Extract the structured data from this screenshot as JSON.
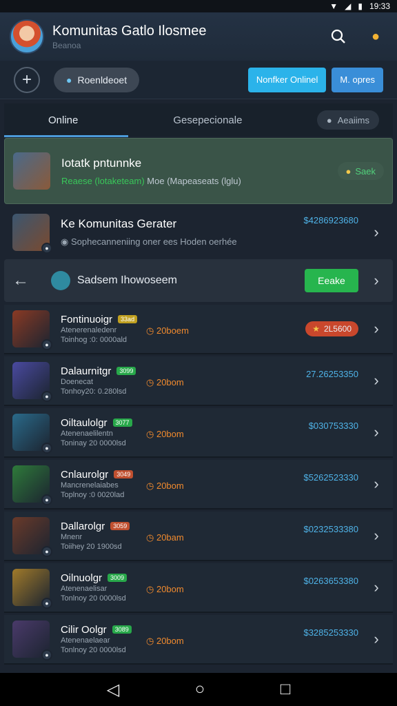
{
  "status": {
    "time": "19:33"
  },
  "header": {
    "title": "Komunitas Gatlo Ilosmee",
    "subtitle": "Beanoa"
  },
  "toolbar": {
    "pill_label": "Roenldeoet",
    "btn1": "Nonfker Onlinel",
    "btn2": "M. opres"
  },
  "tabs": [
    {
      "label": "Online"
    },
    {
      "label": "Gesepecionale"
    }
  ],
  "tab_badge": {
    "label": "Aeaiims"
  },
  "highlight": {
    "name": "Iotatk pntunnke",
    "sub_green": "Reaese (lotaketeam)",
    "sub_rest": "Moe (Mapeaseats (lglu)",
    "action": "Saek"
  },
  "featured": {
    "name": "Ke Komunitas Gerater",
    "sub": "Sophecanneniing oner ees Hoden oerhée",
    "value": "$4286923680"
  },
  "sortbar": {
    "label": "Sadsem Ihowoseem",
    "button": "Eeake"
  },
  "list": [
    {
      "name": "Fontinuoigr",
      "tag": "33ad",
      "line1": "Atenerenaledenr",
      "line2": "Toinhog :0: 0000ald",
      "time": "20boem",
      "value": "2L5600",
      "star": true
    },
    {
      "name": "Dalaurnitgr",
      "tag": "3099",
      "line1": "Doenecat",
      "line2": "Tonhoy20: 0.280lsd",
      "time": "20bom",
      "value": "27.26253350",
      "star": false
    },
    {
      "name": "Oiltaulolgr",
      "tag": "3077",
      "line1": "Atenenaelilentn",
      "line2": "Toninay 20 0000lsd",
      "time": "20bom",
      "value": "$030753330",
      "star": false
    },
    {
      "name": "Cnlaurolgr",
      "tag": "3049",
      "line1": "Mancrenelaiabes",
      "line2": "Toplnoy :0 0020lad",
      "time": "20bom",
      "value": "$5262523330",
      "star": false
    },
    {
      "name": "Dallarolgr",
      "tag": "3059",
      "line1": "Mnenr",
      "line2": "Toiihey 20 1900sd",
      "time": "20bam",
      "value": "$0232533380",
      "star": false
    },
    {
      "name": "Oilnuolgr",
      "tag": "3009",
      "line1": "Atenenaelisar",
      "line2": "Tonlnoy 20 0000lsd",
      "time": "20bom",
      "value": "$0263653380",
      "star": false
    },
    {
      "name": "Cilir Oolgr",
      "tag": "3089",
      "line1": "Atenenaelaear",
      "line2": "Tonlnoy 20 0000lsd",
      "time": "20bom",
      "value": "$3285253330",
      "star": false
    }
  ],
  "colors": {
    "accent": "#4fb3e8",
    "green": "#27b54e",
    "orange": "#f08a2e"
  }
}
